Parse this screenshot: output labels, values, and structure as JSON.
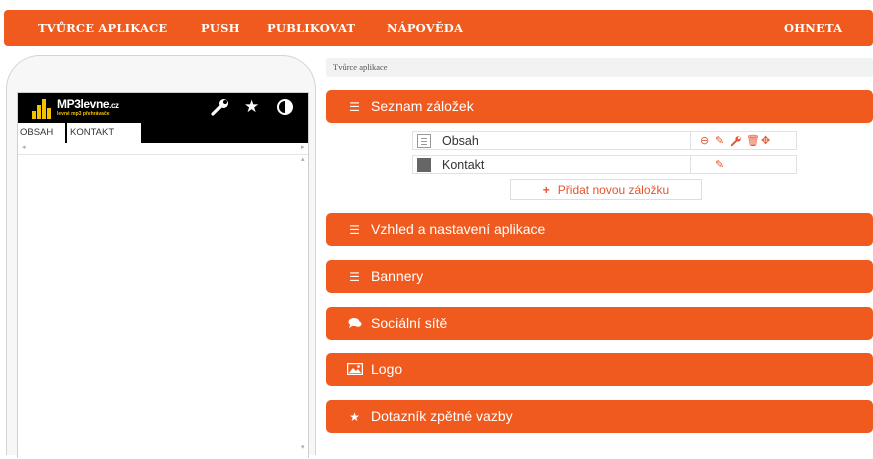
{
  "topnav": {
    "app_builder": "TVŮRCE APLIKACE",
    "push": "PUSH",
    "publish": "PUBLIKOVAT",
    "help": "NÁPOVĚDA",
    "user": "OHNETA"
  },
  "preview": {
    "logo_name": "MP3levne",
    "logo_tld": ".cz",
    "logo_slogan": "levné mp3 přehrávače",
    "tabs": [
      "OBSAH",
      "KONTAKT"
    ],
    "header_icons": [
      "wrench-icon",
      "star-icon",
      "contrast-icon"
    ]
  },
  "breadcrumb": "Tvůrce aplikace",
  "sections": {
    "tabs_list": {
      "label": "Seznam záložek",
      "icon": "list-icon"
    },
    "appearance": {
      "label": "Vzhled a nastavení aplikace",
      "icon": "list-icon"
    },
    "banners": {
      "label": "Bannery",
      "icon": "list-icon"
    },
    "social": {
      "label": "Sociální sítě",
      "icon": "comments-icon"
    },
    "logo": {
      "label": "Logo",
      "icon": "picture-icon"
    },
    "feedback": {
      "label": "Dotazník zpětné vazby",
      "icon": "star-icon"
    }
  },
  "tab_rows": [
    {
      "label": "Obsah",
      "actions": [
        "hide-icon",
        "pencil-icon",
        "wrench-icon",
        "trash-icon",
        "move-icon"
      ]
    },
    {
      "label": "Kontakt",
      "actions": [
        "pencil-icon"
      ]
    }
  ],
  "add_tab": "Přidat novou záložku",
  "colors": {
    "accent": "#f05a1e",
    "action": "#e8542a"
  }
}
